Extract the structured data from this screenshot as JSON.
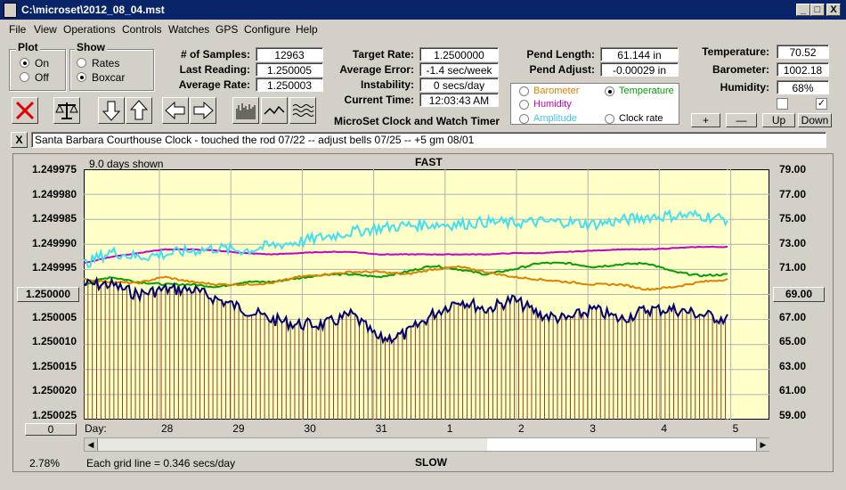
{
  "window": {
    "title": "C:\\microset\\2012_08_04.mst",
    "min_glyph": "_",
    "max_glyph": "□",
    "close_glyph": "X"
  },
  "menu": [
    "File",
    "View",
    "Operations",
    "Controls",
    "Watches",
    "GPS",
    "Configure",
    "Help"
  ],
  "plot_group": {
    "title": "Plot",
    "on": "On",
    "off": "Off",
    "selected": "On"
  },
  "show_group": {
    "title": "Show",
    "rates": "Rates",
    "boxcar": "Boxcar",
    "selected": "Boxcar"
  },
  "stats": {
    "samples_label": "# of Samples:",
    "samples": "12963",
    "last_label": "Last Reading:",
    "last": "1.250005",
    "avg_label": "Average Rate:",
    "avg": "1.250003"
  },
  "rate": {
    "target_label": "Target Rate:",
    "target": "1.2500000",
    "avg_err_label": "Average Error:",
    "avg_err": "-1.4 sec/week",
    "instab_label": "Instability:",
    "instab": "0 secs/day",
    "time_label": "Current Time:",
    "time": "12:03:43 AM"
  },
  "pend": {
    "len_label": "Pend Length:",
    "len": "61.144 in",
    "adj_label": "Pend Adjust:",
    "adj": "-0.00029 in"
  },
  "env": {
    "temp_label": "Temperature:",
    "temp": "70.52",
    "baro_label": "Barometer:",
    "baro": "1002.18",
    "hum_label": "Humidity:",
    "hum": "68%"
  },
  "series_select": {
    "barometer": "Barometer",
    "temperature": "Temperature",
    "humidity": "Humidity",
    "amplitude": "Amplitude",
    "clock_rate": "Clock rate",
    "selected": "Temperature"
  },
  "adjust_buttons": {
    "plus": "+",
    "minus": "—",
    "up": "Up",
    "down": "Down"
  },
  "app_title": "MicroSet Clock and Watch Timer",
  "clear_glyph": "X",
  "notes": "Santa Barbara Courthouse Clock  -  touched the rod 07/22  --  adjust bells 07/25  --  +5 gm 08/01",
  "colors": {
    "plot_bg": "#ffffc8",
    "rate": "#000070",
    "bars": "#8b4513",
    "temperature": "#00a000",
    "humidity": "#c800c8",
    "barometer": "#e08000",
    "amplitude": "#40e0f0"
  },
  "chart": {
    "days_shown": "9.0 days shown",
    "fast": "FAST",
    "slow": "SLOW",
    "day_prefix": "Day:",
    "left_ticks": [
      "1.249975",
      "1.249980",
      "1.249985",
      "1.249990",
      "1.249995",
      "1.250000",
      "1.250005",
      "1.250010",
      "1.250015",
      "1.250020",
      "1.250025"
    ],
    "right_ticks": [
      "79.00",
      "77.00",
      "75.00",
      "73.00",
      "71.00",
      "69.00",
      "67.00",
      "65.00",
      "63.00",
      "61.00",
      "59.00"
    ],
    "center_left": "1.250000",
    "center_right": "69.00",
    "lower_box": "0",
    "days": [
      "28",
      "29",
      "30",
      "31",
      "1",
      "2",
      "3",
      "4",
      "5"
    ],
    "zoom": "2.78%",
    "grid_note": "Each grid line = 0.346 secs/day"
  },
  "chart_data": {
    "type": "line",
    "x_label": "Day:",
    "x_ticks": [
      "28",
      "29",
      "30",
      "31",
      "1",
      "2",
      "3",
      "4",
      "5"
    ],
    "y_left_range": [
      1.250025,
      1.249975
    ],
    "y_right_range": [
      59,
      79
    ],
    "series": [
      {
        "name": "Temperature",
        "values": [
          69.8,
          70.4,
          70.0,
          69.8,
          69.8,
          69.6,
          70.0,
          70.0,
          70.3,
          70.6,
          70.6,
          70.4,
          70.8,
          71.3,
          71.0,
          70.6,
          71.0,
          71.5,
          71.5,
          71.2,
          71.4,
          71.5,
          70.8,
          70.5,
          70.6
        ]
      },
      {
        "name": "Humidity",
        "values": [
          71.5,
          72.0,
          72.3,
          72.6,
          72.6,
          72.5,
          72.3,
          72.2,
          72.3,
          72.4,
          72.4,
          72.2,
          72.2,
          72.2,
          72.2,
          72.2,
          72.3,
          72.3,
          72.4,
          72.5,
          72.6,
          72.6,
          72.7,
          72.8,
          72.8
        ]
      },
      {
        "name": "Barometer",
        "values": [
          70.2,
          70.0,
          69.9,
          70.4,
          70.0,
          69.8,
          69.8,
          69.9,
          70.4,
          70.6,
          70.8,
          70.8,
          70.6,
          71.0,
          71.2,
          70.8,
          70.4,
          70.2,
          70.0,
          69.8,
          69.8,
          69.4,
          69.6,
          70.0,
          70.2
        ]
      },
      {
        "name": "Amplitude",
        "values": [
          71.4,
          72.4,
          72.0,
          72.2,
          72.5,
          72.7,
          72.5,
          72.9,
          73.2,
          73.6,
          74.0,
          74.3,
          74.5,
          74.6,
          74.6,
          74.8,
          74.7,
          74.8,
          74.8,
          74.6,
          74.9,
          75.2,
          75.3,
          75.3,
          75.0
        ]
      },
      {
        "name": "Clock rate",
        "values": [
          1.249998,
          1.249998,
          1.25,
          1.249999,
          1.249999,
          1.250001,
          1.250003,
          1.250005,
          1.250006,
          1.250006,
          1.250004,
          1.250009,
          1.250008,
          1.250004,
          1.250001,
          1.250003,
          1.250001,
          1.250004,
          1.250005,
          1.250003,
          1.250005,
          1.250003,
          1.250003,
          1.250004,
          1.250005
        ]
      }
    ]
  }
}
